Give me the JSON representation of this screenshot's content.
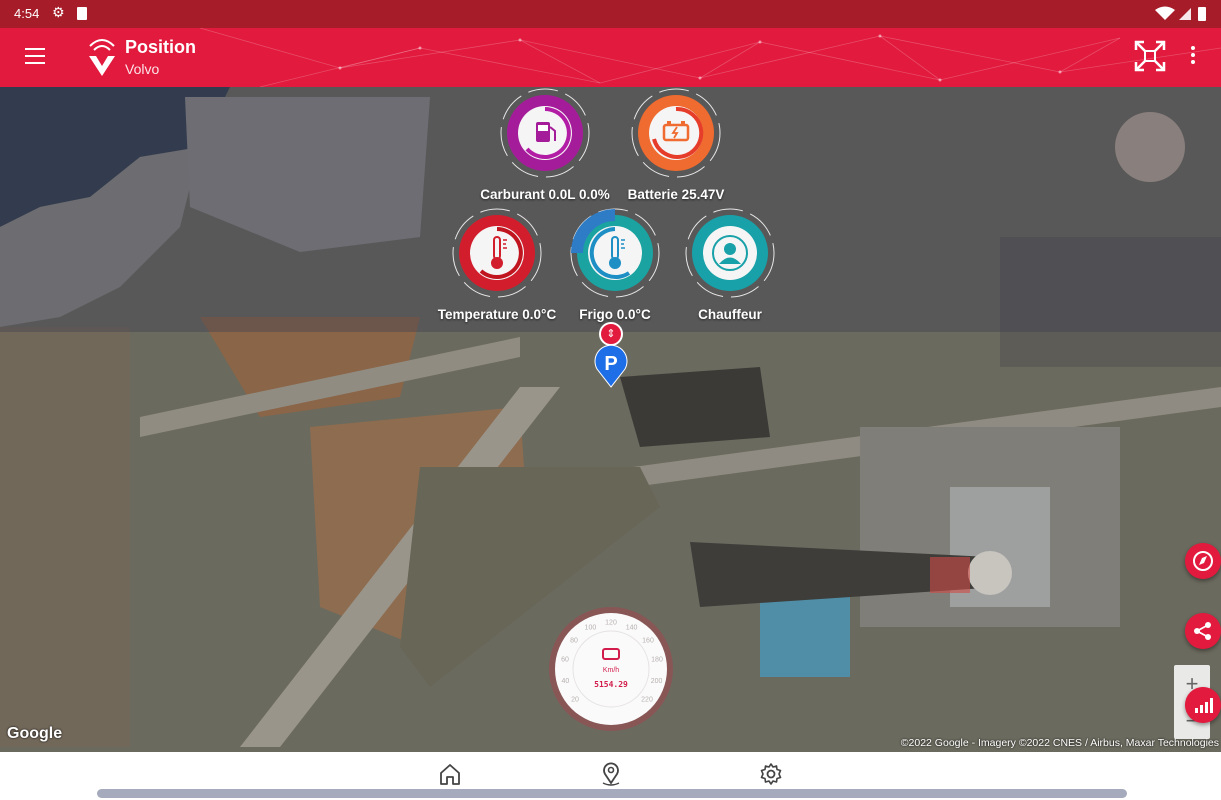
{
  "status_bar": {
    "time": "4:54",
    "gear_icon": "gear-icon",
    "sd_icon": "sd-card-icon"
  },
  "app_bar": {
    "title": "Position",
    "subtitle": "Volvo",
    "accent": "#e21a3e"
  },
  "gauges": {
    "fuel": {
      "label": "Carburant 0.0L 0.0%",
      "icon": "fuel-pump-icon",
      "color": "#a51c9a"
    },
    "battery": {
      "label": "Batterie 25.47V",
      "icon": "battery-icon",
      "color": "#ef6b2f"
    },
    "temperature": {
      "label": "Temperature 0.0°C",
      "icon": "thermometer-icon",
      "color": "#d21d2c"
    },
    "fridge": {
      "label": "Frigo 0.0°C",
      "icon": "thermometer-icon",
      "color": "#1aa3a0"
    },
    "driver": {
      "label": "Chauffeur",
      "icon": "person-icon",
      "color": "#18a1a8"
    }
  },
  "marker": {
    "letter": "P"
  },
  "speedometer": {
    "unit": "Km/h",
    "odometer": "5154.29",
    "ticks": [
      "20",
      "40",
      "60",
      "80",
      "100",
      "120",
      "140",
      "160",
      "180",
      "200",
      "220"
    ]
  },
  "map": {
    "google_logo": "Google",
    "attribution": "©2022 Google - Imagery ©2022 CNES / Airbus, Maxar Technologies"
  },
  "zoom": {
    "in": "+",
    "out": "−"
  },
  "bottom_nav": {
    "home_icon": "home-icon",
    "location_icon": "location-pin-icon",
    "settings_icon": "gear-icon"
  }
}
